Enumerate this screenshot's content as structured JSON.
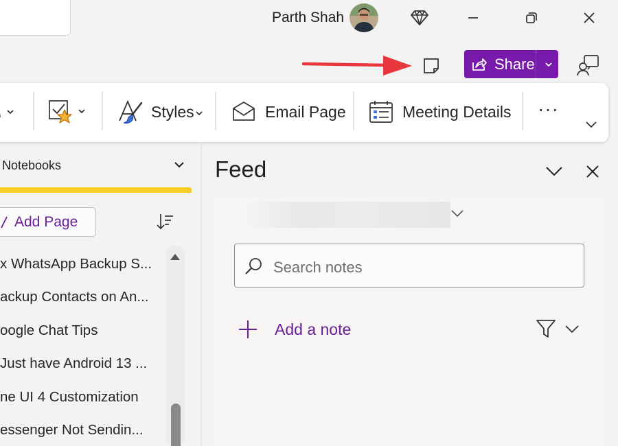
{
  "titlebar": {
    "user_name": "Parth Shah"
  },
  "toolbar": {
    "share_label": "Share"
  },
  "ribbon": {
    "styles_label": "Styles",
    "email_page_label": "Email Page",
    "meeting_details_label": "Meeting Details",
    "more_label": "···"
  },
  "sidebar": {
    "notebooks_label": "Notebooks",
    "add_page_label": "Add Page",
    "pages": [
      "x WhatsApp Backup S...",
      "ackup Contacts on An...",
      "oogle Chat Tips",
      "Just have Android 13 ...",
      "ne UI 4 Customization",
      "essenger Not Sendin..."
    ]
  },
  "feed": {
    "title": "Feed",
    "search_placeholder": "Search notes",
    "add_note_label": "Add a note"
  },
  "colors": {
    "accent": "#7719aa",
    "accent_text": "#6b1f95",
    "notebook_tab": "#f8cd27",
    "annotation_arrow": "#e8383d"
  }
}
